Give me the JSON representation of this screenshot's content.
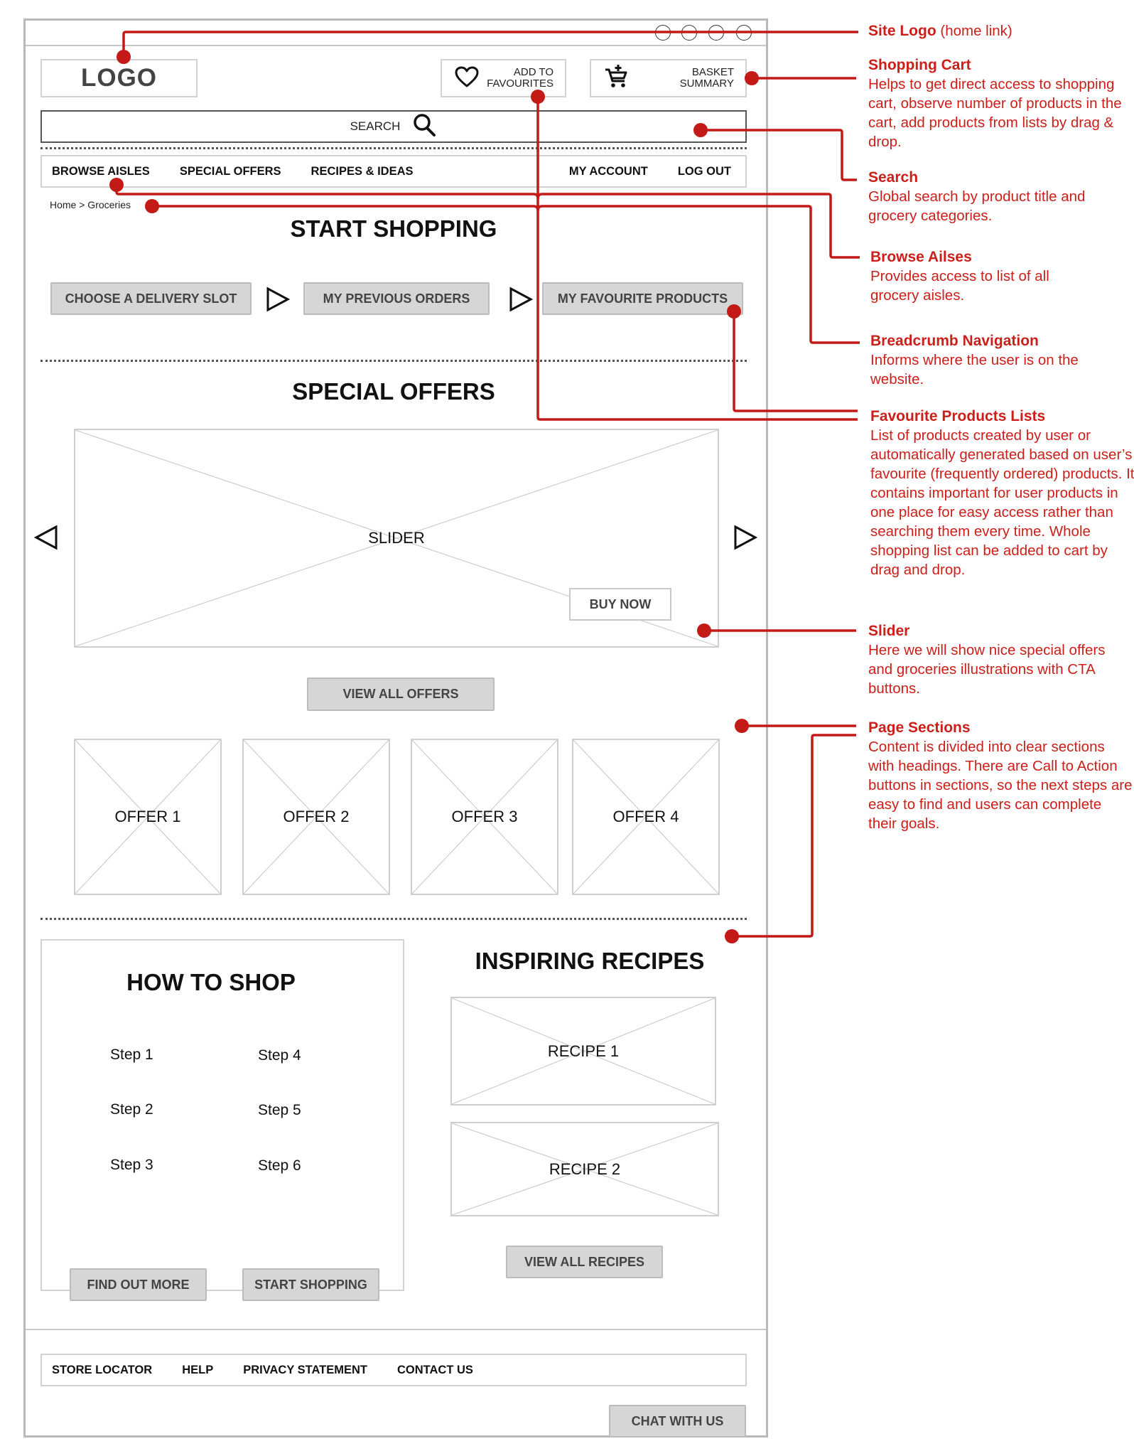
{
  "colors": {
    "annotation": "#cc1f1a",
    "button_fill": "#d6d6d6",
    "wire_border": "#c9c9c9"
  },
  "header": {
    "logo": "LOGO",
    "favourites": {
      "icon": "heart-icon",
      "line1": "ADD TO",
      "line2": "FAVOURITES"
    },
    "basket": {
      "icon": "cart-add-icon",
      "line1": "BASKET",
      "line2": "SUMMARY"
    },
    "search": {
      "label": "SEARCH",
      "icon": "search-icon"
    }
  },
  "nav": {
    "left": [
      "BROWSE AISLES",
      "SPECIAL OFFERS",
      "RECIPES & IDEAS"
    ],
    "right": [
      "MY ACCOUNT",
      "LOG OUT"
    ]
  },
  "breadcrumb": "Home > Groceries",
  "start_shopping": {
    "title": "START SHOPPING",
    "steps": [
      "CHOOSE A DELIVERY SLOT",
      "MY PREVIOUS ORDERS",
      "MY FAVOURITE PRODUCTS"
    ],
    "arrow_icon": "play-arrow-icon"
  },
  "special_offers": {
    "title": "SPECIAL OFFERS",
    "slider_label": "SLIDER",
    "buy_now": "BUY NOW",
    "prev_icon": "triangle-left-icon",
    "next_icon": "triangle-right-icon",
    "view_all": "VIEW ALL OFFERS",
    "offers": [
      "OFFER 1",
      "OFFER 2",
      "OFFER 3",
      "OFFER 4"
    ]
  },
  "how_to_shop": {
    "title": "HOW TO SHOP",
    "steps": [
      "Step 1",
      "Step 2",
      "Step 3",
      "Step 4",
      "Step 5",
      "Step 6"
    ],
    "find_out_more": "FIND OUT MORE",
    "start_shopping": "START SHOPPING"
  },
  "recipes": {
    "title": "INSPIRING RECIPES",
    "items": [
      "RECIPE 1",
      "RECIPE 2"
    ],
    "view_all": "VIEW ALL RECIPES"
  },
  "footer": {
    "links": [
      "STORE LOCATOR",
      "HELP",
      "PRIVACY STATEMENT",
      "CONTACT US"
    ],
    "chat": "CHAT WITH US"
  },
  "annotations": [
    {
      "title": "Site Logo",
      "inline": "(home link)",
      "body": ""
    },
    {
      "title": "Shopping Cart",
      "body": "Helps to get direct access to shopping cart, observe number of products in the cart, add products from lists by drag & drop."
    },
    {
      "title": "Search",
      "body": "Global search by product title and grocery categories."
    },
    {
      "title": "Browse Ailses",
      "body": "Provides access to list of all grocery aisles."
    },
    {
      "title": "Breadcrumb Navigation",
      "body": "Informs where the user is on the website."
    },
    {
      "title": "Favourite Products Lists",
      "body": "List of products created by user or automatically generated based on user’s favourite (frequently ordered) products. It contains important for user products in one place for easy access rather than searching them every time. Whole shopping list can be added to cart by drag and drop."
    },
    {
      "title": "Slider",
      "body": "Here we will show nice special offers and groceries illustrations with CTA buttons."
    },
    {
      "title": "Page Sections",
      "body": "Content is divided into clear sections with headings. There are Call to Action buttons in sections, so the next steps are easy to find and users can complete their goals."
    }
  ]
}
